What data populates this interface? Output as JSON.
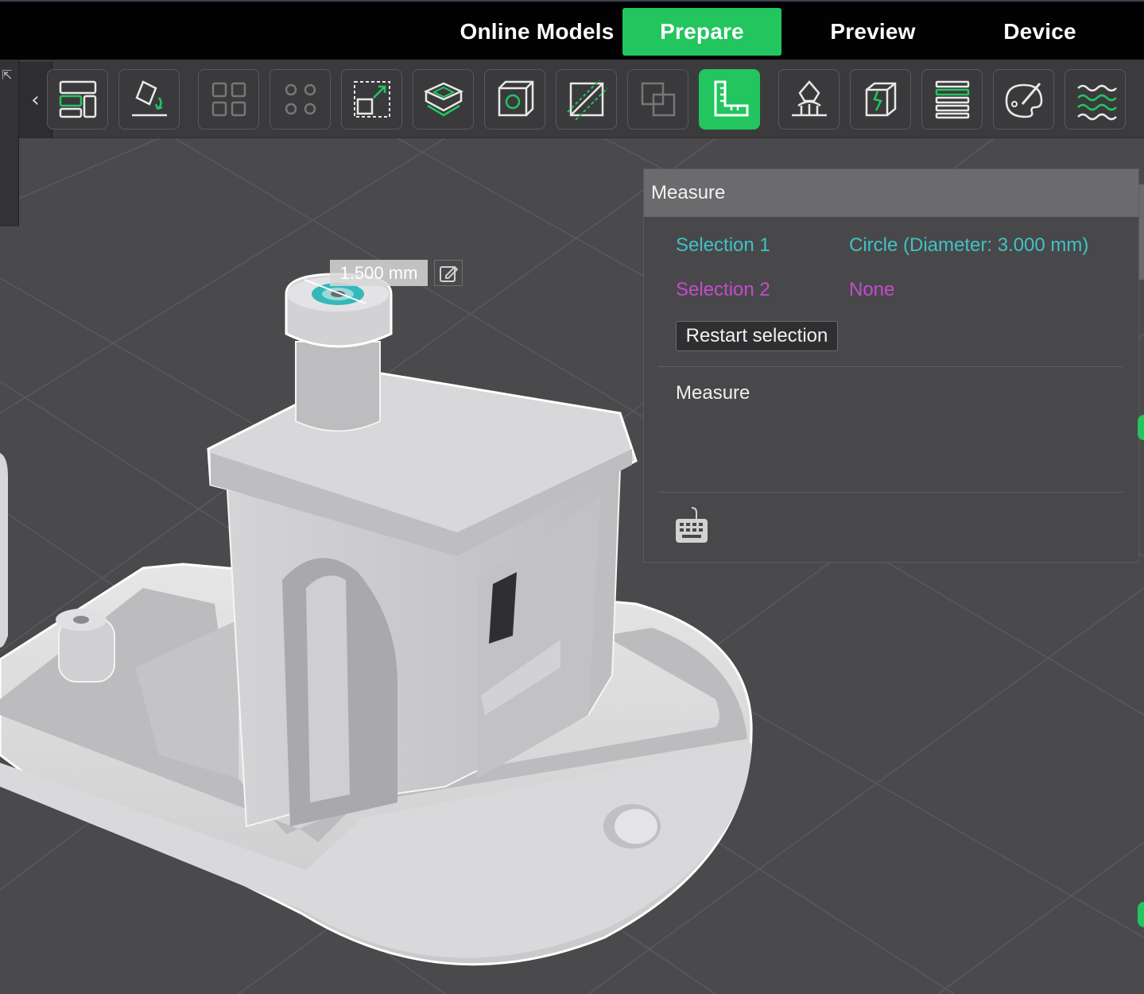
{
  "topbar": {
    "tabs": [
      {
        "label": "Online Models",
        "active": false
      },
      {
        "label": "Prepare",
        "active": true
      },
      {
        "label": "Preview",
        "active": false
      },
      {
        "label": "Device",
        "active": false
      }
    ],
    "accent_color": "#22c55e"
  },
  "toolbar": {
    "collapse_glyph": "‹",
    "buttons": [
      {
        "icon": "arrange-icon"
      },
      {
        "icon": "lay-on-face-icon"
      },
      {
        "icon": "split-objects-icon"
      },
      {
        "icon": "split-parts-icon"
      },
      {
        "icon": "scale-icon"
      },
      {
        "icon": "plate-icon"
      },
      {
        "icon": "cut-cube-icon"
      },
      {
        "icon": "cut-icon"
      },
      {
        "icon": "boolean-icon"
      },
      {
        "icon": "measure-icon",
        "active": true
      },
      {
        "icon": "support-paint-icon"
      },
      {
        "icon": "seam-paint-icon"
      },
      {
        "icon": "variable-layer-height-icon"
      },
      {
        "icon": "color-paint-icon"
      },
      {
        "icon": "fuzzy-skin-icon"
      }
    ]
  },
  "viewport": {
    "dimension_label": "1.500 mm"
  },
  "measure_panel": {
    "title": "Measure",
    "selection1_label": "Selection 1",
    "selection1_value": "Circle (Diameter: 3.000 mm)",
    "selection2_label": "Selection 2",
    "selection2_value": "None",
    "restart_button": "Restart selection",
    "measure_section_label": "Measure",
    "selection1_color": "#3fc2c4",
    "selection2_color": "#c54bcd"
  }
}
